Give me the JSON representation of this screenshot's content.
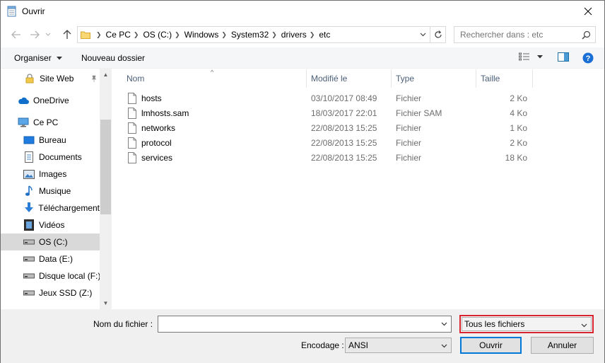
{
  "window": {
    "title": "Ouvrir"
  },
  "address": {
    "crumbs": [
      "Ce PC",
      "OS (C:)",
      "Windows",
      "System32",
      "drivers",
      "etc"
    ]
  },
  "search": {
    "placeholder": "Rechercher dans : etc"
  },
  "toolbar": {
    "organize_label": "Organiser",
    "new_folder_label": "Nouveau dossier"
  },
  "sidebar": {
    "items": [
      {
        "label": "Site Web",
        "icon": "lock-folder-icon"
      },
      {
        "label": "OneDrive",
        "icon": "cloud-icon"
      },
      {
        "label": "Ce PC",
        "icon": "computer-icon"
      },
      {
        "label": "Bureau",
        "icon": "desktop-icon"
      },
      {
        "label": "Documents",
        "icon": "documents-icon"
      },
      {
        "label": "Images",
        "icon": "images-icon"
      },
      {
        "label": "Musique",
        "icon": "music-icon"
      },
      {
        "label": "Téléchargement",
        "icon": "download-icon"
      },
      {
        "label": "Vidéos",
        "icon": "video-icon"
      },
      {
        "label": "OS (C:)",
        "icon": "drive-icon"
      },
      {
        "label": "Data (E:)",
        "icon": "drive-icon"
      },
      {
        "label": "Disque local (F:)",
        "icon": "drive-icon"
      },
      {
        "label": "Jeux SSD (Z:)",
        "icon": "drive-icon"
      }
    ]
  },
  "columns": [
    "Nom",
    "Modifié le",
    "Type",
    "Taille"
  ],
  "files": [
    {
      "name": "hosts",
      "modified": "03/10/2017 08:49",
      "type": "Fichier",
      "size": "2 Ko"
    },
    {
      "name": "lmhosts.sam",
      "modified": "18/03/2017 22:01",
      "type": "Fichier SAM",
      "size": "4 Ko"
    },
    {
      "name": "networks",
      "modified": "22/08/2013 15:25",
      "type": "Fichier",
      "size": "1 Ko"
    },
    {
      "name": "protocol",
      "modified": "22/08/2013 15:25",
      "type": "Fichier",
      "size": "2 Ko"
    },
    {
      "name": "services",
      "modified": "22/08/2013 15:25",
      "type": "Fichier",
      "size": "18 Ko"
    }
  ],
  "bottom": {
    "filename_label": "Nom du fichier :",
    "filename_value": "",
    "filter_value": "Tous les fichiers",
    "encoding_label": "Encodage :",
    "encoding_value": "ANSI",
    "open_label": "Ouvrir",
    "cancel_label": "Annuler"
  },
  "colors": {
    "accent": "#0078d7",
    "highlight_border": "#d9232e",
    "selection": "#d9d9d9"
  }
}
